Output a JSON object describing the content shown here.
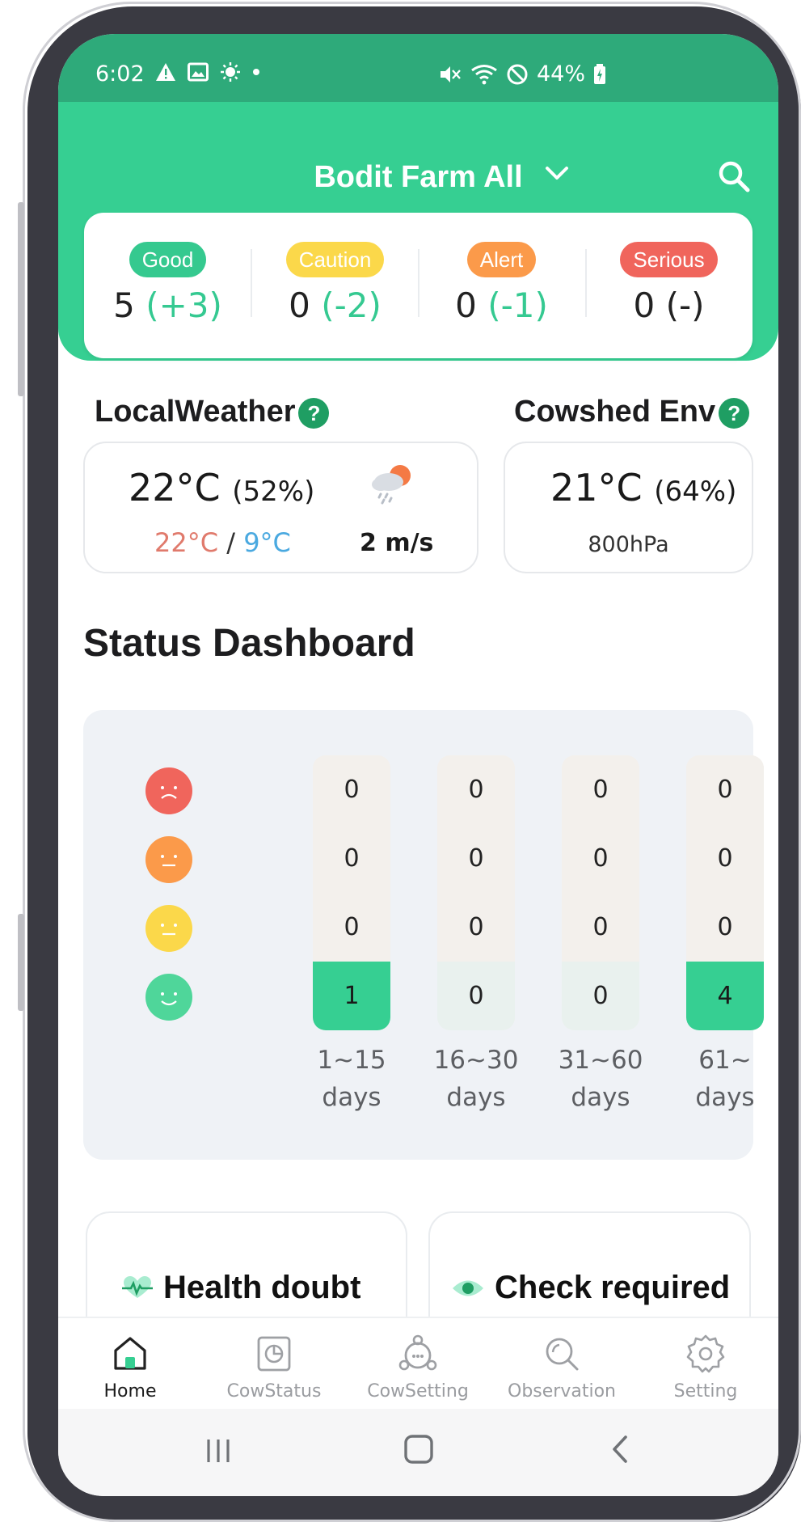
{
  "status_bar": {
    "time": "6:02",
    "battery": "44%"
  },
  "header": {
    "farm_name": "Bodit Farm All"
  },
  "summary": [
    {
      "label": "Good",
      "value": "5",
      "delta": "(+3)",
      "color": "#36cf92",
      "delta_color": "green"
    },
    {
      "label": "Caution",
      "value": "0",
      "delta": "(-2)",
      "color": "#fbd84a",
      "delta_color": "green"
    },
    {
      "label": "Alert",
      "value": "0",
      "delta": "(-1)",
      "color": "#fb9a4a",
      "delta_color": "green"
    },
    {
      "label": "Serious",
      "value": "0",
      "delta": "(-)",
      "color": "#f0655c",
      "delta_color": "dark"
    }
  ],
  "local_weather": {
    "title": "LocalWeather",
    "temp": "22°C",
    "humidity": "(52%)",
    "high": "22°C",
    "separator": "/",
    "low": "9°C",
    "wind": "2 m/s",
    "icon": "rain-sun-icon"
  },
  "cowshed_env": {
    "title": "Cowshed Env",
    "temp": "21°C",
    "humidity": "(64%)",
    "pressure": "800hPa"
  },
  "dashboard": {
    "title": "Status Dashboard",
    "rows": [
      "serious",
      "alert",
      "caution",
      "good"
    ],
    "row_colors": [
      "#f0655c",
      "#fb9a4a",
      "#fbd84a",
      "#4fd69a"
    ],
    "columns": [
      {
        "line1": "1~15",
        "line2": "days",
        "values": [
          "0",
          "0",
          "0",
          "1"
        ],
        "good_active": true
      },
      {
        "line1": "16~30",
        "line2": "days",
        "values": [
          "0",
          "0",
          "0",
          "0"
        ],
        "good_active": false
      },
      {
        "line1": "31~60",
        "line2": "days",
        "values": [
          "0",
          "0",
          "0",
          "0"
        ],
        "good_active": false
      },
      {
        "line1": "61~",
        "line2": "days",
        "values": [
          "0",
          "0",
          "0",
          "4"
        ],
        "good_active": true
      }
    ]
  },
  "cards": {
    "health_doubt": "Health doubt",
    "check_required": "Check required"
  },
  "nav": [
    {
      "label": "Home",
      "icon": "home-icon",
      "active": true
    },
    {
      "label": "CowStatus",
      "icon": "cow-status-icon",
      "active": false
    },
    {
      "label": "CowSetting",
      "icon": "cow-setting-icon",
      "active": false
    },
    {
      "label": "Observation",
      "icon": "observation-icon",
      "active": false
    },
    {
      "label": "Setting",
      "icon": "gear-icon",
      "active": false
    }
  ]
}
